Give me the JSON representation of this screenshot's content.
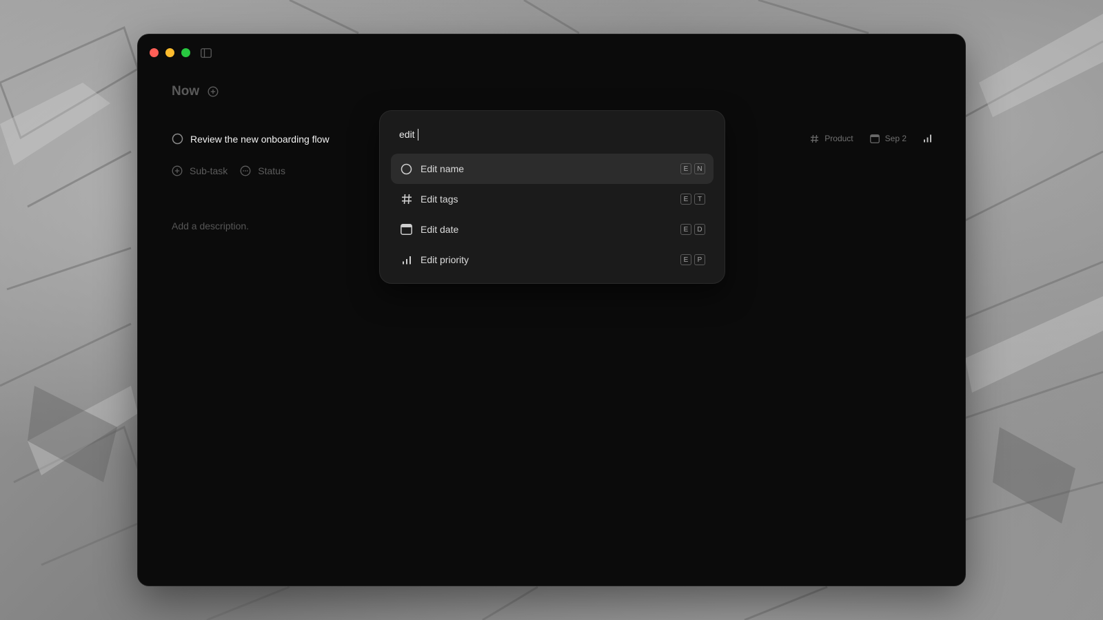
{
  "colors": {
    "window_bg": "#0b0b0b",
    "palette_bg": "#1b1b1b",
    "close": "#ff5f57",
    "minimize": "#febc2e",
    "zoom": "#28c840"
  },
  "window": {
    "sidebar_toggle_icon": "sidebar-icon"
  },
  "page": {
    "title": "Now",
    "add_icon": "plus-circle-icon"
  },
  "task": {
    "title": "Review the new onboarding flow",
    "status_icon": "circle-icon",
    "sub_task_label": "Sub-task",
    "status_label": "Status",
    "description_placeholder": "Add a description."
  },
  "meta": {
    "tag": "Product",
    "date": "Sep 2",
    "tag_icon": "hash-icon",
    "date_icon": "calendar-icon",
    "priority_icon": "priority-bars-icon"
  },
  "palette": {
    "query": "edit",
    "options": [
      {
        "label": "Edit name",
        "icon": "circle-icon",
        "keys": [
          "E",
          "N"
        ],
        "active": true
      },
      {
        "label": "Edit tags",
        "icon": "hash-icon",
        "keys": [
          "E",
          "T"
        ],
        "active": false
      },
      {
        "label": "Edit date",
        "icon": "calendar-icon",
        "keys": [
          "E",
          "D"
        ],
        "active": false
      },
      {
        "label": "Edit priority",
        "icon": "priority-bars-icon",
        "keys": [
          "E",
          "P"
        ],
        "active": false
      }
    ]
  }
}
